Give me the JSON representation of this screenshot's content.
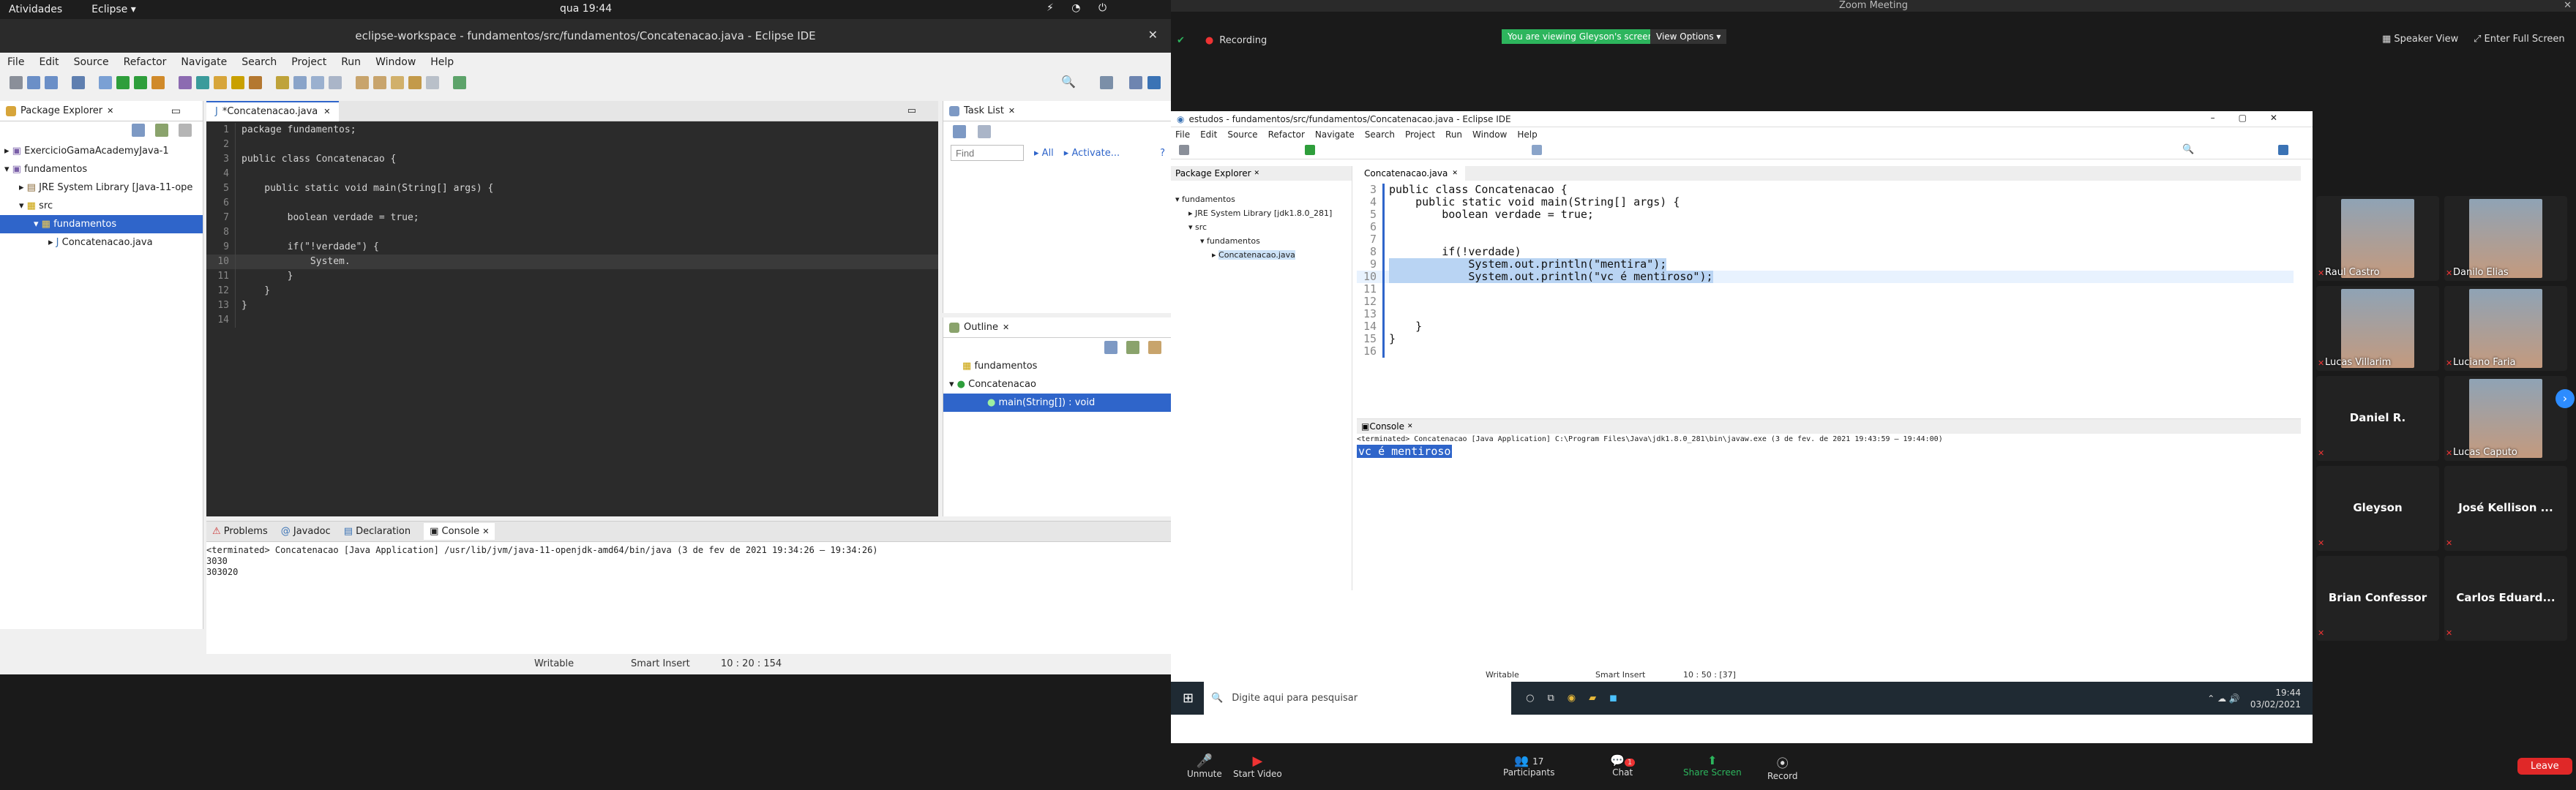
{
  "gnome": {
    "activities": "Atividades",
    "app": "Eclipse",
    "clock": "qua 19:44"
  },
  "eclipse": {
    "title": "eclipse-workspace - fundamentos/src/fundamentos/Concatenacao.java - Eclipse IDE",
    "menu": [
      "File",
      "Edit",
      "Source",
      "Refactor",
      "Navigate",
      "Search",
      "Project",
      "Run",
      "Window",
      "Help"
    ],
    "package_explorer": {
      "title": "Package Explorer",
      "items": [
        {
          "label": "ExercicioGamaAcademyJava-1",
          "depth": 0
        },
        {
          "label": "fundamentos",
          "depth": 0
        },
        {
          "label": "JRE System Library [Java-11-ope",
          "depth": 1
        },
        {
          "label": "src",
          "depth": 1
        },
        {
          "label": "fundamentos",
          "depth": 2
        },
        {
          "label": "Concatenacao.java",
          "depth": 3
        }
      ]
    },
    "editor": {
      "tab": "*Concatenacao.java",
      "lines": [
        {
          "n": "1",
          "code": "package fundamentos;"
        },
        {
          "n": "2",
          "code": ""
        },
        {
          "n": "3",
          "code": "public class Concatenacao {"
        },
        {
          "n": "4",
          "code": ""
        },
        {
          "n": "5",
          "code": "    public static void main(String[] args) {"
        },
        {
          "n": "6",
          "code": ""
        },
        {
          "n": "7",
          "code": "        boolean verdade = true;"
        },
        {
          "n": "8",
          "code": ""
        },
        {
          "n": "9",
          "code": "        if(\"!verdade\") {"
        },
        {
          "n": "10",
          "code": "            System."
        },
        {
          "n": "11",
          "code": "        }"
        },
        {
          "n": "12",
          "code": "    }"
        },
        {
          "n": "13",
          "code": "}"
        },
        {
          "n": "14",
          "code": ""
        }
      ]
    },
    "task_list": {
      "title": "Task List",
      "find_placeholder": "Find",
      "all": "All",
      "activate": "Activate..."
    },
    "outline": {
      "title": "Outline",
      "items": [
        "fundamentos",
        "Concatenacao",
        "main(String[]) : void"
      ]
    },
    "bottom_tabs": [
      "Problems",
      "Javadoc",
      "Declaration",
      "Console"
    ],
    "console": {
      "terminated": "<terminated> Concatenacao [Java Application] /usr/lib/jvm/java-11-openjdk-amd64/bin/java  (3 de fev de 2021 19:34:26 – 19:34:26)",
      "lines": [
        "3030",
        "303020"
      ]
    },
    "status": {
      "writable": "Writable",
      "insert": "Smart Insert",
      "pos": "10 : 20 : 154"
    }
  },
  "zoom": {
    "title": "Zoom Meeting",
    "recording": "Recording",
    "banner": "You are viewing Gleyson's screen",
    "view_options": "View Options",
    "speaker_view": "Speaker View",
    "full_screen": "Enter Full Screen",
    "shared": {
      "title": "estudos - fundamentos/src/fundamentos/Concatenacao.java - Eclipse IDE",
      "menu": [
        "File",
        "Edit",
        "Source",
        "Refactor",
        "Navigate",
        "Search",
        "Project",
        "Run",
        "Window",
        "Help"
      ],
      "pe_title": "Package Explorer",
      "tree": [
        "fundamentos",
        "JRE System Library [jdk1.8.0_281]",
        "src",
        "fundamentos",
        "Concatenacao.java"
      ],
      "tab": "Concatenacao.java",
      "lines": [
        {
          "n": "3",
          "code": "public class Concatenacao {"
        },
        {
          "n": "4",
          "code": "    public static void main(String[] args) {"
        },
        {
          "n": "5",
          "code": "        boolean verdade = true;"
        },
        {
          "n": "6",
          "code": ""
        },
        {
          "n": "7",
          "code": ""
        },
        {
          "n": "8",
          "code": "        if(!verdade)"
        },
        {
          "n": "9",
          "code": "            System.out.println(\"mentira\");"
        },
        {
          "n": "10",
          "code": "            System.out.println(\"vc é mentiroso\");"
        },
        {
          "n": "11",
          "code": ""
        },
        {
          "n": "12",
          "code": ""
        },
        {
          "n": "13",
          "code": ""
        },
        {
          "n": "14",
          "code": "    }"
        },
        {
          "n": "15",
          "code": "}"
        },
        {
          "n": "16",
          "code": ""
        }
      ],
      "console_title": "Console",
      "terminated": "<terminated> Concatenacao [Java Application] C:\\Program Files\\Java\\jdk1.8.0_281\\bin\\javaw.exe  (3 de fev. de 2021 19:43:59 – 19:44:00)",
      "output": "vc é mentiroso",
      "status": {
        "writable": "Writable",
        "insert": "Smart Insert",
        "pos": "10 : 50 : [37]"
      },
      "taskbar": {
        "search": "Digite aqui para pesquisar",
        "time": "19:44",
        "date": "03/02/2021"
      }
    },
    "participants": [
      {
        "name": "Raul Castro",
        "video": true
      },
      {
        "name": "Danilo Elias",
        "video": true
      },
      {
        "name": "Lucas Villarim",
        "video": true
      },
      {
        "name": "Luciano Faria",
        "video": true
      },
      {
        "name": "Daniel R.",
        "video": false
      },
      {
        "name": "Lucas Caputo",
        "video": true
      },
      {
        "name": "Gleyson",
        "video": false
      },
      {
        "name": "José Kellison ...",
        "video": false
      },
      {
        "name": "Brian Confessor",
        "video": false
      },
      {
        "name": "Carlos Eduard...",
        "video": false
      }
    ],
    "controls": {
      "unmute": "Unmute",
      "start_video": "Start Video",
      "participants": "Participants",
      "participants_count": "17",
      "chat": "Chat",
      "chat_badge": "1",
      "share": "Share Screen",
      "record": "Record",
      "leave": "Leave"
    }
  }
}
